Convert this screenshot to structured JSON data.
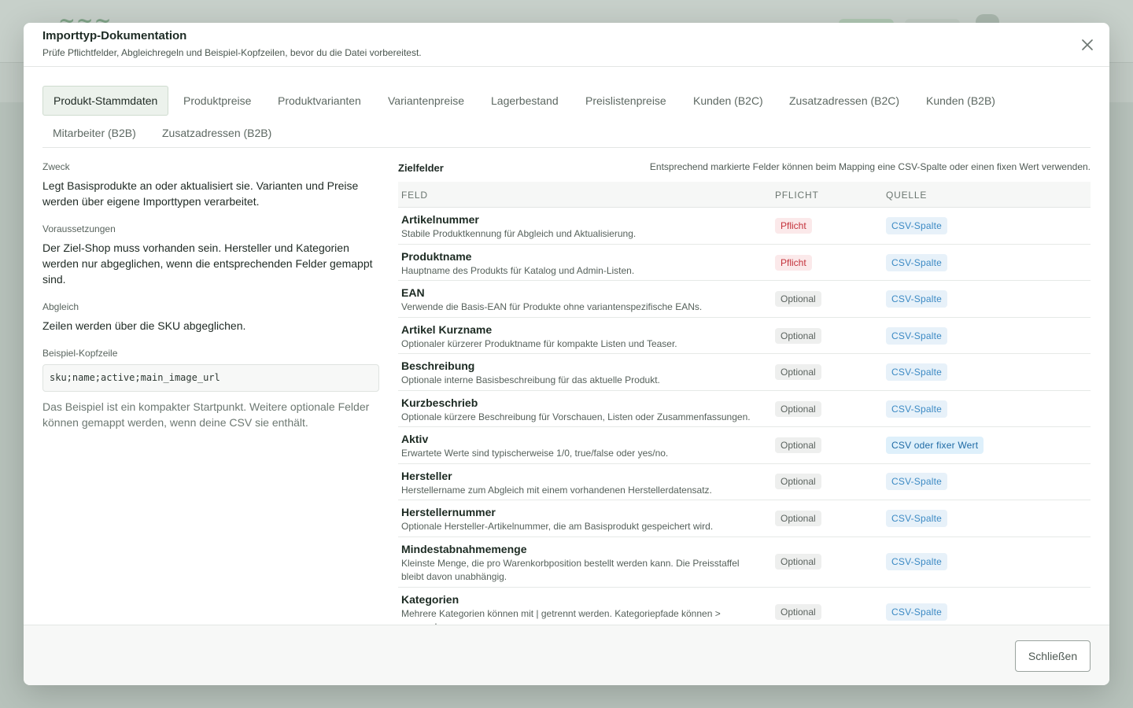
{
  "modal": {
    "title": "Importtyp-Dokumentation",
    "subtitle": "Prüfe Pflichtfelder, Abgleichregeln und Beispiel-Kopfzeilen, bevor du die Datei vorbereitest.",
    "close_icon": "close-icon"
  },
  "tabs": [
    {
      "label": "Produkt-Stammdaten",
      "active": true
    },
    {
      "label": "Produktpreise"
    },
    {
      "label": "Produktvarianten"
    },
    {
      "label": "Variantenpreise"
    },
    {
      "label": "Lagerbestand"
    },
    {
      "label": "Preislistenpreise"
    },
    {
      "label": "Kunden (B2C)"
    },
    {
      "label": "Zusatzadressen (B2C)"
    },
    {
      "label": "Kunden (B2B)"
    },
    {
      "label": "Mitarbeiter (B2B)"
    },
    {
      "label": "Zusatzadressen (B2B)"
    }
  ],
  "info": {
    "zweck_label": "Zweck",
    "zweck_text": "Legt Basisprodukte an oder aktualisiert sie. Varianten und Preise werden über eigene Importtypen verarbeitet.",
    "voraussetzungen_label": "Voraussetzungen",
    "voraussetzungen_text": "Der Ziel-Shop muss vorhanden sein. Hersteller und Kategorien werden nur abgeglichen, wenn die entsprechenden Felder gemappt sind.",
    "abgleich_label": "Abgleich",
    "abgleich_text": "Zeilen werden über die SKU abgeglichen.",
    "beispiel_label": "Beispiel-Kopfzeile",
    "beispiel_code": "sku;name;active;main_image_url",
    "hinweis": "Das Beispiel ist ein kompakter Startpunkt. Weitere optionale Felder können gemappt werden, wenn deine CSV sie enthält."
  },
  "zielfelder": {
    "title": "Zielfelder",
    "note": "Entsprechend markierte Felder können beim Mapping eine CSV-Spalte oder einen fixen Wert verwenden.",
    "columns": [
      "FELD",
      "PFLICHT",
      "QUELLE"
    ],
    "rows": [
      {
        "name": "Artikelnummer",
        "desc": "Stabile Produktkennung für Abgleich und Aktualisierung.",
        "pflicht": "Pflicht",
        "quelle": "CSV-Spalte"
      },
      {
        "name": "Produktname",
        "desc": "Hauptname des Produkts für Katalog und Admin-Listen.",
        "pflicht": "Pflicht",
        "quelle": "CSV-Spalte"
      },
      {
        "name": "EAN",
        "desc": "Verwende die Basis-EAN für Produkte ohne variantenspezifische EANs.",
        "pflicht": "Optional",
        "quelle": "CSV-Spalte"
      },
      {
        "name": "Artikel Kurzname",
        "desc": "Optionaler kürzerer Produktname für kompakte Listen und Teaser.",
        "pflicht": "Optional",
        "quelle": "CSV-Spalte"
      },
      {
        "name": "Beschreibung",
        "desc": "Optionale interne Basisbeschreibung für das aktuelle Produkt.",
        "pflicht": "Optional",
        "quelle": "CSV-Spalte"
      },
      {
        "name": "Kurzbeschrieb",
        "desc": "Optionale kürzere Beschreibung für Vorschauen, Listen oder Zusammenfassungen.",
        "pflicht": "Optional",
        "quelle": "CSV-Spalte"
      },
      {
        "name": "Aktiv",
        "desc": "Erwartete Werte sind typischerweise 1/0, true/false oder yes/no.",
        "pflicht": "Optional",
        "quelle": "CSV oder fixer Wert"
      },
      {
        "name": "Hersteller",
        "desc": "Herstellername zum Abgleich mit einem vorhandenen Herstellerdatensatz.",
        "pflicht": "Optional",
        "quelle": "CSV-Spalte"
      },
      {
        "name": "Herstellernummer",
        "desc": "Optionale Hersteller-Artikelnummer, die am Basisprodukt gespeichert wird.",
        "pflicht": "Optional",
        "quelle": "CSV-Spalte"
      },
      {
        "name": "Mindestabnahmemenge",
        "desc": "Kleinste Menge, die pro Warenkorbposition bestellt werden kann. Die Preisstaffel bleibt davon unabhängig.",
        "pflicht": "Optional",
        "quelle": "CSV-Spalte"
      },
      {
        "name": "Kategorien",
        "desc": "Mehrere Kategorien können mit | getrennt werden. Kategoriepfade können > verwenden.",
        "pflicht": "Optional",
        "quelle": "CSV-Spalte"
      }
    ]
  },
  "footer": {
    "close_label": "Schließen"
  }
}
